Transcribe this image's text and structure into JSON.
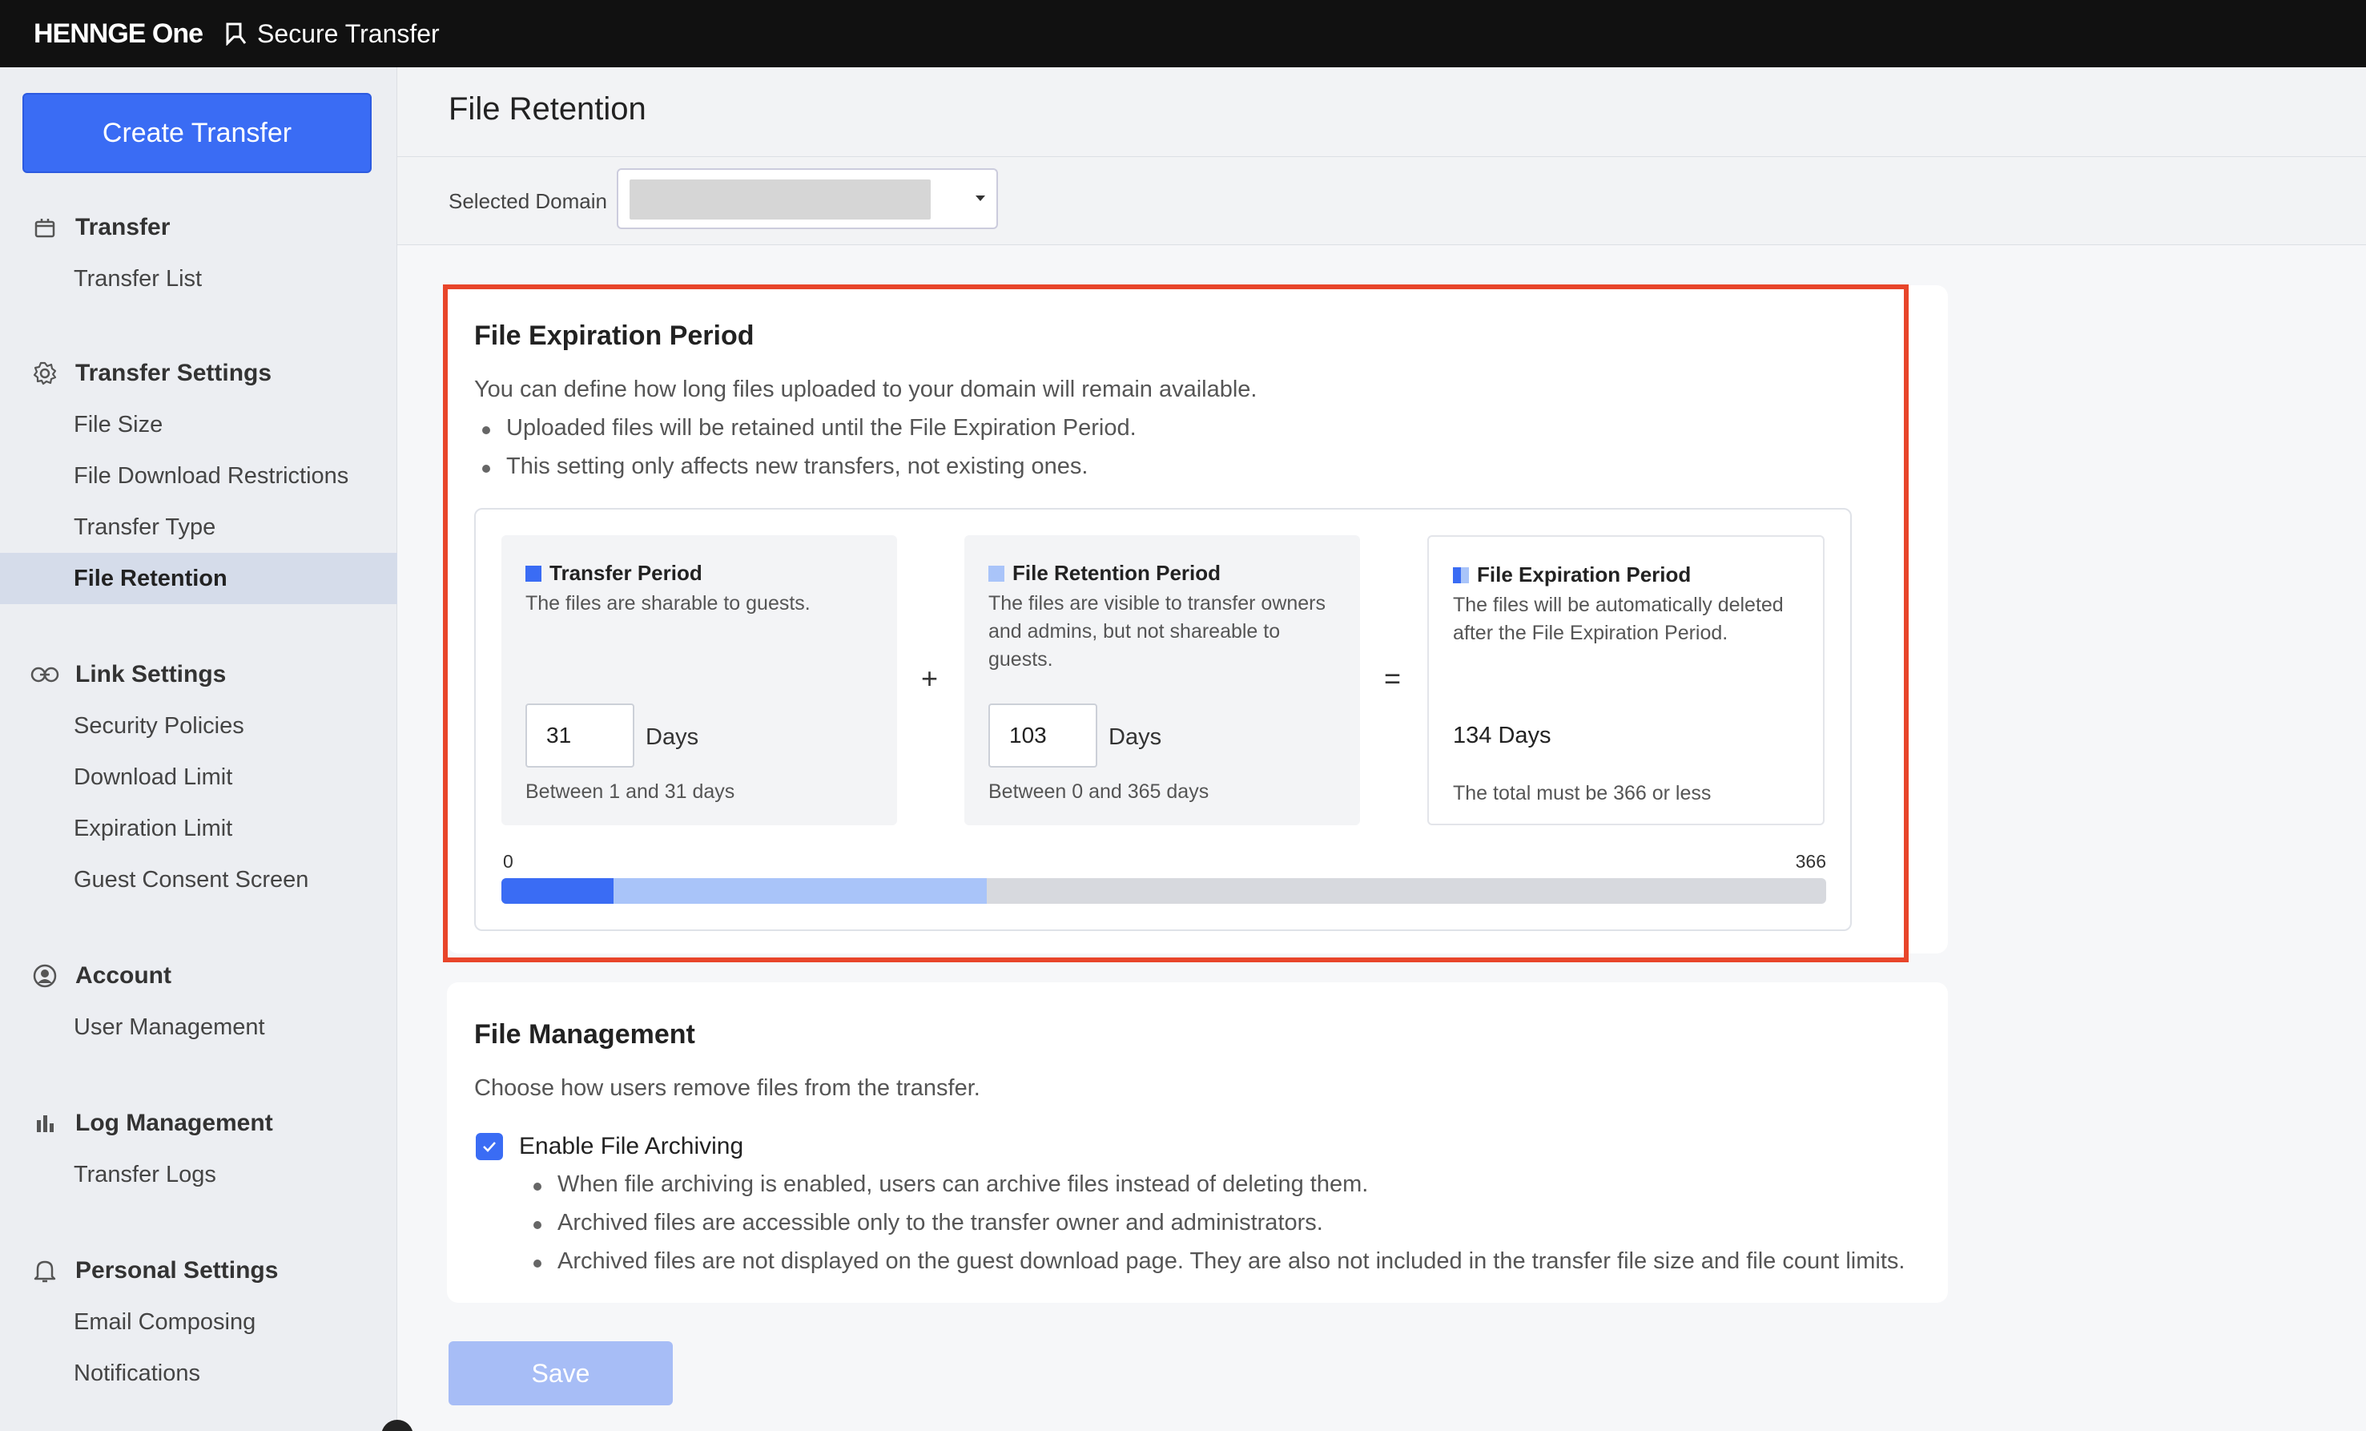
{
  "topbar": {
    "brand": "HENNGE One",
    "product": "Secure Transfer"
  },
  "sidebar": {
    "create_label": "Create Transfer",
    "groups": [
      {
        "head": "Transfer",
        "icon": "box-icon",
        "items": [
          "Transfer List"
        ]
      },
      {
        "head": "Transfer Settings",
        "icon": "gear-icon",
        "items": [
          "File Size",
          "File Download Restrictions",
          "Transfer Type",
          "File Retention"
        ]
      },
      {
        "head": "Link Settings",
        "icon": "link-icon",
        "items": [
          "Security Policies",
          "Download Limit",
          "Expiration Limit",
          "Guest Consent Screen"
        ]
      },
      {
        "head": "Account",
        "icon": "user-circle-icon",
        "items": [
          "User Management"
        ]
      },
      {
        "head": "Log Management",
        "icon": "bar-chart-icon",
        "items": [
          "Transfer Logs"
        ]
      },
      {
        "head": "Personal Settings",
        "icon": "bell-icon",
        "items": [
          "Email Composing",
          "Notifications"
        ]
      }
    ],
    "active_item": "File Retention"
  },
  "page": {
    "title": "File Retention",
    "domain_label": "Selected Domain"
  },
  "expiration": {
    "title": "File Expiration Period",
    "description": "You can define how long files uploaded to your domain will remain available.",
    "bullets": [
      "Uploaded files will be retained until the File Expiration Period.",
      "This setting only affects new transfers, not existing ones."
    ],
    "transfer": {
      "title": "Transfer Period",
      "desc": "The files are sharable to guests.",
      "value": "31",
      "unit": "Days",
      "hint": "Between 1 and 31 days"
    },
    "plus": "+",
    "retention": {
      "title": "File Retention Period",
      "desc": "The files are visible to transfer owners and admins, but not shareable to guests.",
      "value": "103",
      "unit": "Days",
      "hint": "Between 0 and 365 days"
    },
    "equals": "=",
    "total": {
      "title": "File Expiration Period",
      "desc": "The files will be automatically deleted after the File Expiration Period.",
      "value": "134 Days",
      "hint": "The total must be 366 or less"
    },
    "bar": {
      "min_label": "0",
      "max_label": "366",
      "max": 366,
      "transfer_days": 31,
      "retention_days": 103
    }
  },
  "file_management": {
    "title": "File Management",
    "description": "Choose how users remove files from the transfer.",
    "checkbox_label": "Enable File Archiving",
    "checked": true,
    "bullets": [
      "When file archiving is enabled, users can archive files instead of deleting them.",
      "Archived files are accessible only to the transfer owner and administrators.",
      "Archived files are not displayed on the guest download page. They are also not included in the transfer file size and file count limits."
    ]
  },
  "save_label": "Save",
  "colors": {
    "accent": "#3a6cf4",
    "retention": "#a9c4f9",
    "highlight": "#e8452a"
  }
}
